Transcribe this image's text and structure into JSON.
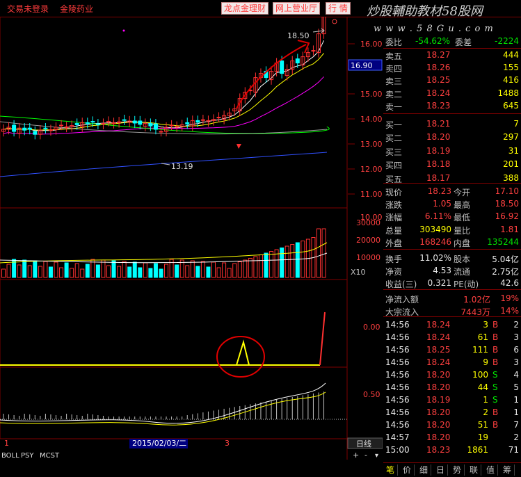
{
  "topbar": {
    "login": "交易未登录",
    "stock_name": "金陵药业",
    "buttons": [
      "龙点金理财",
      "网上营业厅",
      "行  情"
    ],
    "watermark": "炒股輔助教材58股网",
    "watermark_url": "w w w . 5 8 G u . c o m"
  },
  "main_chart": {
    "high_label": "18.50",
    "low_label": "13.19",
    "current_price_tag": "16.90",
    "y_ticks": [
      "16.00",
      "15.00",
      "14.00",
      "13.00",
      "12.00",
      "11.00",
      "10.00"
    ],
    "colors": {
      "up": "#ff3030",
      "down": "#00ffff",
      "ma1": "#ffffff",
      "ma2": "#ffff00",
      "ma3": "#ff00ff",
      "ma4": "#00ff00",
      "ma5": "#3050ff"
    }
  },
  "volume_chart": {
    "y_ticks": [
      "30000",
      "20000",
      "10000"
    ],
    "unit": "X10"
  },
  "indicator1": {
    "y_ticks": [
      "0.00"
    ]
  },
  "indicator2": {
    "y_ticks": [
      "0.50"
    ]
  },
  "time_axis": {
    "labels": [
      "1",
      "2015/02/03/二",
      "3"
    ],
    "period": "日线",
    "zoom_in": "+",
    "zoom_out": "-"
  },
  "indicator_tabs": [
    "BOLL",
    "PSY",
    "MCST"
  ],
  "order_book": {
    "weibi_label": "委比",
    "weibi": "-54.62%",
    "weicha_label": "委差",
    "weicha": "-2224",
    "asks": [
      {
        "label": "卖五",
        "price": "18.27",
        "vol": "444"
      },
      {
        "label": "卖四",
        "price": "18.26",
        "vol": "155"
      },
      {
        "label": "卖三",
        "price": "18.25",
        "vol": "416"
      },
      {
        "label": "卖二",
        "price": "18.24",
        "vol": "1488"
      },
      {
        "label": "卖一",
        "price": "18.23",
        "vol": "645"
      }
    ],
    "bids": [
      {
        "label": "买一",
        "price": "18.21",
        "vol": "7"
      },
      {
        "label": "买二",
        "price": "18.20",
        "vol": "297"
      },
      {
        "label": "买三",
        "price": "18.19",
        "vol": "31"
      },
      {
        "label": "买四",
        "price": "18.18",
        "vol": "201"
      },
      {
        "label": "买五",
        "price": "18.17",
        "vol": "388"
      }
    ]
  },
  "quote": {
    "rows": [
      {
        "l1": "现价",
        "v1": "18.23",
        "c1": "red",
        "l2": "今开",
        "v2": "17.10",
        "c2": "red"
      },
      {
        "l1": "涨跌",
        "v1": "1.05",
        "c1": "red",
        "l2": "最高",
        "v2": "18.50",
        "c2": "red"
      },
      {
        "l1": "涨幅",
        "v1": "6.11%",
        "c1": "red",
        "l2": "最低",
        "v2": "16.92",
        "c2": "red"
      },
      {
        "l1": "总量",
        "v1": "303490",
        "c1": "yellow",
        "l2": "量比",
        "v2": "1.81",
        "c2": "red"
      },
      {
        "l1": "外盘",
        "v1": "168246",
        "c1": "red",
        "l2": "内盘",
        "v2": "135244",
        "c2": "green"
      }
    ],
    "rows2": [
      {
        "l1": "换手",
        "v1": "11.02%",
        "l2": "股本",
        "v2": "5.04亿"
      },
      {
        "l1": "净资",
        "v1": "4.53",
        "l2": "流通",
        "v2": "2.75亿"
      },
      {
        "l1": "收益(三)",
        "v1": "0.321",
        "l2": "PE(动)",
        "v2": "42.6"
      }
    ],
    "flow": [
      {
        "label": "净流入额",
        "value": "1.02亿",
        "pct": "19%"
      },
      {
        "label": "大宗流入",
        "value": "7443万",
        "pct": "14%"
      }
    ]
  },
  "ticks": [
    {
      "time": "14:56",
      "price": "18.24",
      "vol": "3",
      "bs": "B",
      "n": "2"
    },
    {
      "time": "14:56",
      "price": "18.24",
      "vol": "61",
      "bs": "B",
      "n": "3"
    },
    {
      "time": "14:56",
      "price": "18.25",
      "vol": "111",
      "bs": "B",
      "n": "6"
    },
    {
      "time": "14:56",
      "price": "18.24",
      "vol": "9",
      "bs": "B",
      "n": "3"
    },
    {
      "time": "14:56",
      "price": "18.20",
      "vol": "100",
      "bs": "S",
      "n": "4"
    },
    {
      "time": "14:56",
      "price": "18.20",
      "vol": "44",
      "bs": "S",
      "n": "5"
    },
    {
      "time": "14:56",
      "price": "18.19",
      "vol": "1",
      "bs": "S",
      "n": "1"
    },
    {
      "time": "14:56",
      "price": "18.20",
      "vol": "2",
      "bs": "B",
      "n": "1"
    },
    {
      "time": "14:56",
      "price": "18.20",
      "vol": "51",
      "bs": "B",
      "n": "7"
    },
    {
      "time": "14:57",
      "price": "18.20",
      "vol": "19",
      "bs": "",
      "n": "2"
    },
    {
      "time": "15:00",
      "price": "18.23",
      "vol": "1861",
      "bs": "",
      "n": "71"
    }
  ],
  "bottom_tabs": [
    "笔",
    "价",
    "细",
    "日",
    "势",
    "联",
    "值",
    "筹"
  ]
}
